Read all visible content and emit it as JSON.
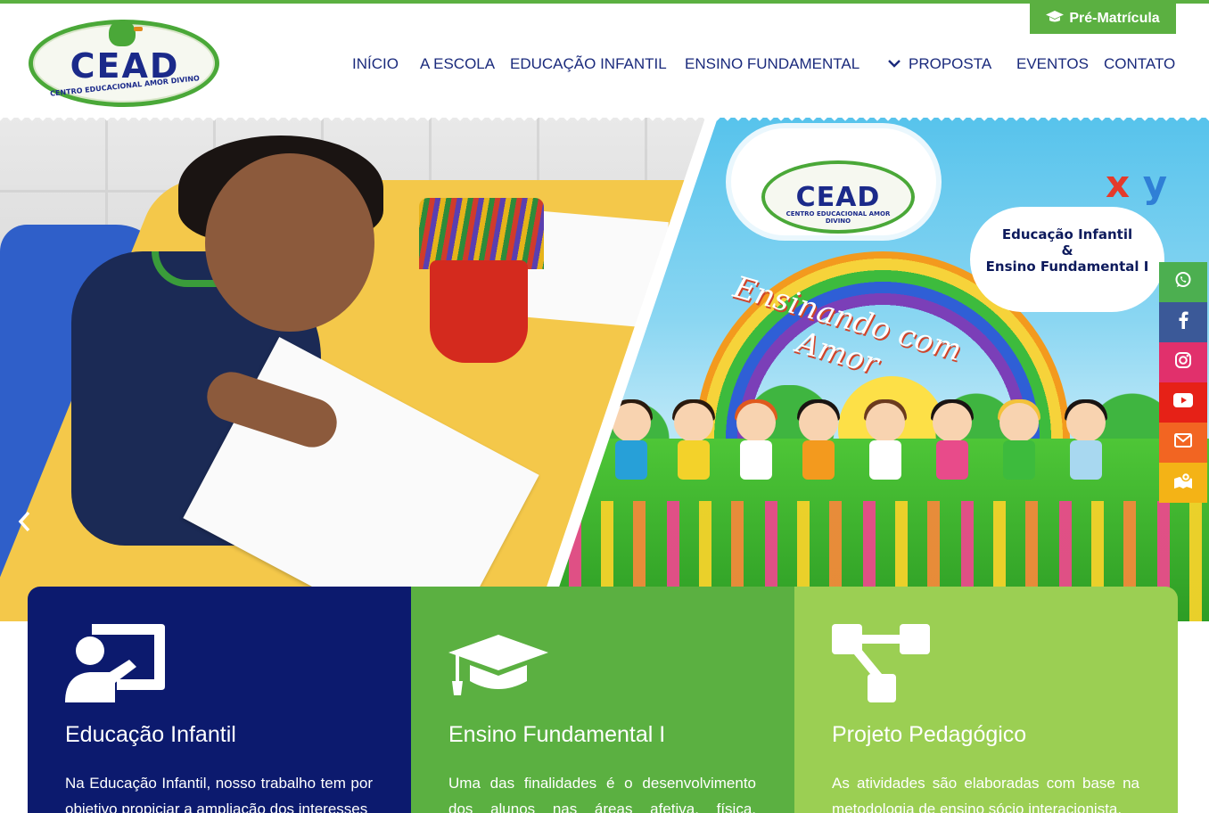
{
  "header": {
    "logo": {
      "main": "CEAD",
      "sub": "CENTRO EDUCACIONAL AMOR DIVINO"
    },
    "pre_matricula": "Pré-Matrícula",
    "nav": [
      {
        "label": "INÍCIO"
      },
      {
        "label": "A ESCOLA"
      },
      {
        "label": "EDUCAÇÃO INFANTIL"
      },
      {
        "label": "ENSINO FUNDAMENTAL"
      },
      {
        "label": "PROPOSTA"
      },
      {
        "label": "EVENTOS"
      },
      {
        "label": "CONTATO"
      }
    ]
  },
  "hero": {
    "slogan": "Ensinando com Amor",
    "logo_main": "CEAD",
    "logo_sub": "CENTRO EDUCACIONAL AMOR DIVINO",
    "cloud_line1": "Educação Infantil",
    "cloud_line2": "&",
    "cloud_line3": "Ensino Fundamental I",
    "letters": [
      "x",
      "y"
    ],
    "prev_arrow": "‹"
  },
  "social": [
    {
      "icon": "whatsapp-icon",
      "color": "#4caf50"
    },
    {
      "icon": "facebook-icon",
      "color": "#3b5998"
    },
    {
      "icon": "instagram-icon",
      "color": "#e1306c"
    },
    {
      "icon": "youtube-icon",
      "color": "#e62117"
    },
    {
      "icon": "mail-icon",
      "color": "#f26522"
    },
    {
      "icon": "map-icon",
      "color": "#f4b316"
    }
  ],
  "cards": [
    {
      "title": "Educação Infantil",
      "text": "Na Educação Infantil, nosso trabalho tem por objetivo propiciar a ampliação dos interesses",
      "color": "#0c1a6e",
      "icon": "teacher-board-icon"
    },
    {
      "title": "Ensino Fundamental I",
      "text": "Uma das finalidades é o desenvolvimento dos alunos nas áreas afetiva, física, cognitiva,",
      "color": "#5bb041",
      "icon": "graduation-cap-icon"
    },
    {
      "title": "Projeto Pedagógico",
      "text": "As atividades são elaboradas com base na metodologia de ensino sócio interacionista,",
      "color": "#9bcf53",
      "icon": "sitemap-icon"
    }
  ]
}
